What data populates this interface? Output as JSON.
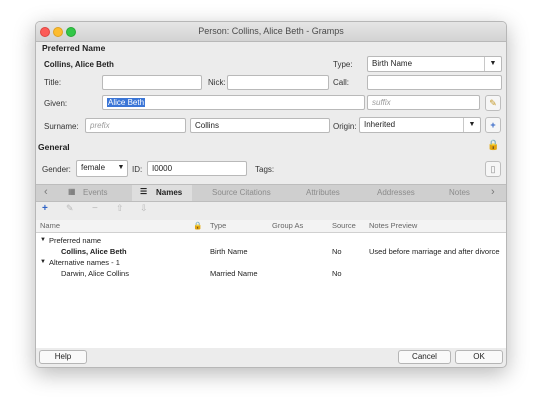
{
  "window": {
    "title": "Person: Collins, Alice Beth - Gramps"
  },
  "preferred_name": {
    "section_title": "Preferred Name",
    "display_name": "Collins, Alice Beth",
    "type_label": "Type:",
    "type_value": "Birth Name",
    "title_label": "Title:",
    "title_value": "",
    "nick_label": "Nick:",
    "nick_value": "",
    "call_label": "Call:",
    "call_value": "",
    "given_label": "Given:",
    "given_value": "Alice Beth",
    "suffix_placeholder": "suffix",
    "surname_label": "Surname:",
    "prefix_placeholder": "prefix",
    "surname_value": "Collins",
    "origin_label": "Origin:",
    "origin_value": "Inherited"
  },
  "general": {
    "section_title": "General",
    "gender_label": "Gender:",
    "gender_value": "female",
    "id_label": "ID:",
    "id_value": "I0000",
    "tags_label": "Tags:",
    "tags_value": ""
  },
  "tabs": [
    {
      "label": "Events"
    },
    {
      "label": "Names"
    },
    {
      "label": "Source Citations"
    },
    {
      "label": "Attributes"
    },
    {
      "label": "Addresses"
    },
    {
      "label": "Notes"
    }
  ],
  "columns": {
    "name": "Name",
    "type": "Type",
    "group_as": "Group As",
    "source": "Source",
    "notes_preview": "Notes Preview"
  },
  "rows": [
    {
      "name": "Preferred name",
      "type": "",
      "source": "",
      "notes": ""
    },
    {
      "name": "Collins, Alice Beth",
      "type": "Birth Name",
      "source": "No",
      "notes": "Used before marriage and after divorce"
    },
    {
      "name": "Alternative names - 1",
      "type": "",
      "source": "",
      "notes": ""
    },
    {
      "name": "Darwin, Alice Collins",
      "type": "Married Name",
      "source": "No",
      "notes": ""
    }
  ],
  "buttons": {
    "help": "Help",
    "cancel": "Cancel",
    "ok": "OK"
  },
  "colors": {
    "accent": "#3a75d6",
    "plus": "#2f63c6"
  }
}
